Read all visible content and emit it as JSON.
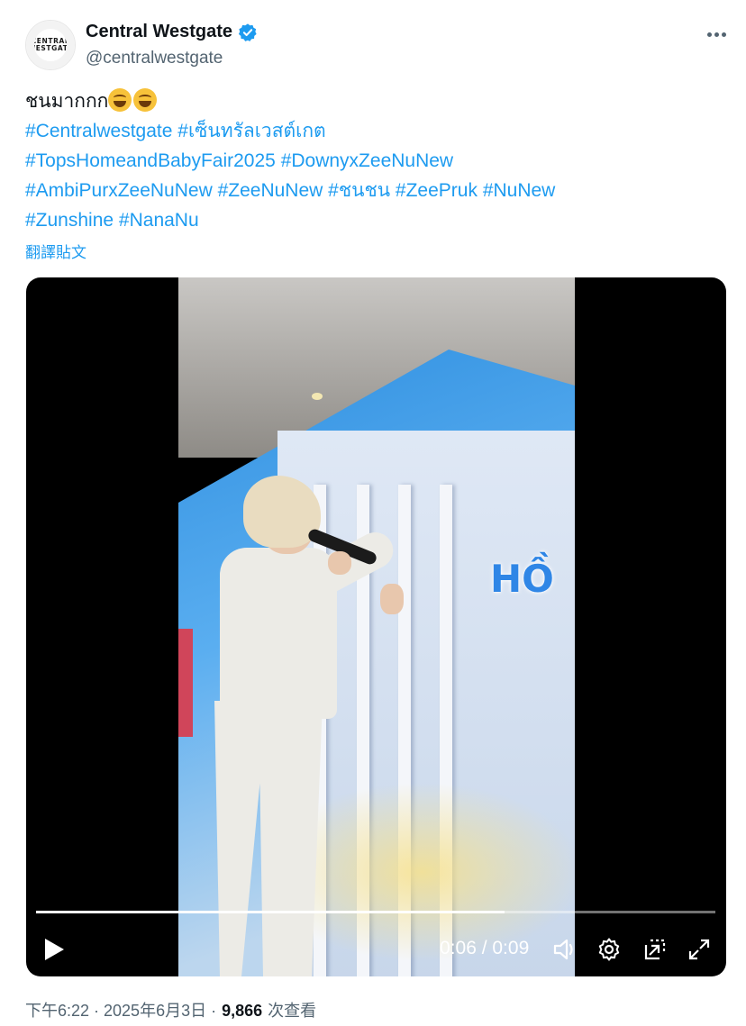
{
  "author": {
    "display_name": "Central Westgate",
    "handle": "@centralwestgate",
    "avatar_text": "CENTRAL WESTGATE",
    "verified": true
  },
  "tweet": {
    "first_line_text": "ชนมากกก",
    "emoji": [
      "rolling-on-floor-laughing",
      "rolling-on-floor-laughing"
    ],
    "hashtags": [
      "#Centralwestgate",
      "#เซ็นทรัลเวสต์เกต",
      "#TopsHomeandBabyFair2025",
      "#DownyxZeeNuNew",
      "#AmbiPurxZeeNuNew",
      "#ZeeNuNew",
      "#ชนชน",
      "#ZeePruk",
      "#NuNew",
      "#Zunshine",
      "#NanaNu"
    ],
    "translate_label": "翻譯貼文"
  },
  "video": {
    "sign_text": "HỒ",
    "progress_fraction": 0.69,
    "time_readout": "0:06 / 0:09",
    "controls": [
      "play-icon",
      "volume-icon",
      "settings-icon",
      "pop-out-icon",
      "fullscreen-icon"
    ]
  },
  "meta": {
    "timestamp": "下午6:22 · 2025年6月3日 · ",
    "views_count": "9,866",
    "views_label": "次查看"
  },
  "colors": {
    "link": "#1d9bf0",
    "secondary_text": "#536471",
    "primary_text": "#0f1419",
    "verified": "#1d9bf0"
  }
}
